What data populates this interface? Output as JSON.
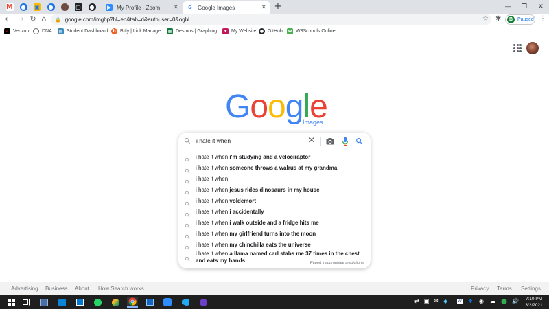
{
  "browser": {
    "tabs": [
      {
        "title": "My Profile - Zoom"
      },
      {
        "title": "Google Images"
      }
    ],
    "new_tab_symbol": "+",
    "close_symbol": "✕",
    "window_controls": [
      "—",
      "❐",
      "✕"
    ],
    "url": "google.com/imghp?hl=en&tab=ri&authuser=0&ogbl",
    "profile": {
      "initial": "B",
      "status": "Paused"
    }
  },
  "bookmarks": [
    {
      "label": "Verizon",
      "icon": "verizon-icon",
      "color": "#000000"
    },
    {
      "label": "DNA",
      "icon": "globe-icon",
      "color": "#5f6368"
    },
    {
      "label": "Student Dashboard...",
      "icon": "dashboard-icon",
      "color": "#3c8dbc"
    },
    {
      "label": "Bitly | Link Manage...",
      "icon": "bitly-icon",
      "color": "#ee6123"
    },
    {
      "label": "Desmos | Graphing...",
      "icon": "desmos-icon",
      "color": "#127a3c"
    },
    {
      "label": "My Website",
      "icon": "website-icon",
      "color": "#c2185b"
    },
    {
      "label": "GitHub",
      "icon": "github-icon",
      "color": "#24292e"
    },
    {
      "label": "W3Schools Online...",
      "icon": "w3schools-icon",
      "color": "#4caf50"
    }
  ],
  "logo": {
    "letters": [
      "G",
      "o",
      "o",
      "g",
      "l",
      "e"
    ],
    "colors": [
      "#4285f4",
      "#ea4335",
      "#fbbc05",
      "#4285f4",
      "#34a853",
      "#ea4335"
    ],
    "subtitle": "Images"
  },
  "search": {
    "query": "i hate it when",
    "suggestions": [
      {
        "prefix": "i hate it when ",
        "completion": "i'm studying and a velociraptor"
      },
      {
        "prefix": "i hate it when ",
        "completion": "someone throws a walrus at my grandma"
      },
      {
        "prefix": "i hate it when",
        "completion": ""
      },
      {
        "prefix": "i hate it when ",
        "completion": "jesus rides dinosaurs in my house"
      },
      {
        "prefix": "i hate it when ",
        "completion": "voldemort"
      },
      {
        "prefix": "i hate it when ",
        "completion": "i accidentally"
      },
      {
        "prefix": "i hate it when ",
        "completion": "i walk outside and a fridge hits me"
      },
      {
        "prefix": "i hate it when ",
        "completion": "my girlfriend turns into the moon"
      },
      {
        "prefix": "i hate it when ",
        "completion": "my chinchilla eats the universe"
      },
      {
        "prefix": "i hate it when ",
        "completion": "a llama named carl stabs me 37 times in the chest and eats my hands"
      }
    ],
    "report_text": "Report inappropriate predictions"
  },
  "footer": {
    "left": [
      "Advertising",
      "Business",
      "About",
      "How Search works"
    ],
    "right": [
      "Privacy",
      "Terms",
      "Settings"
    ]
  },
  "taskbar": {
    "time": "7:10 PM",
    "date": "3/2/2021"
  }
}
